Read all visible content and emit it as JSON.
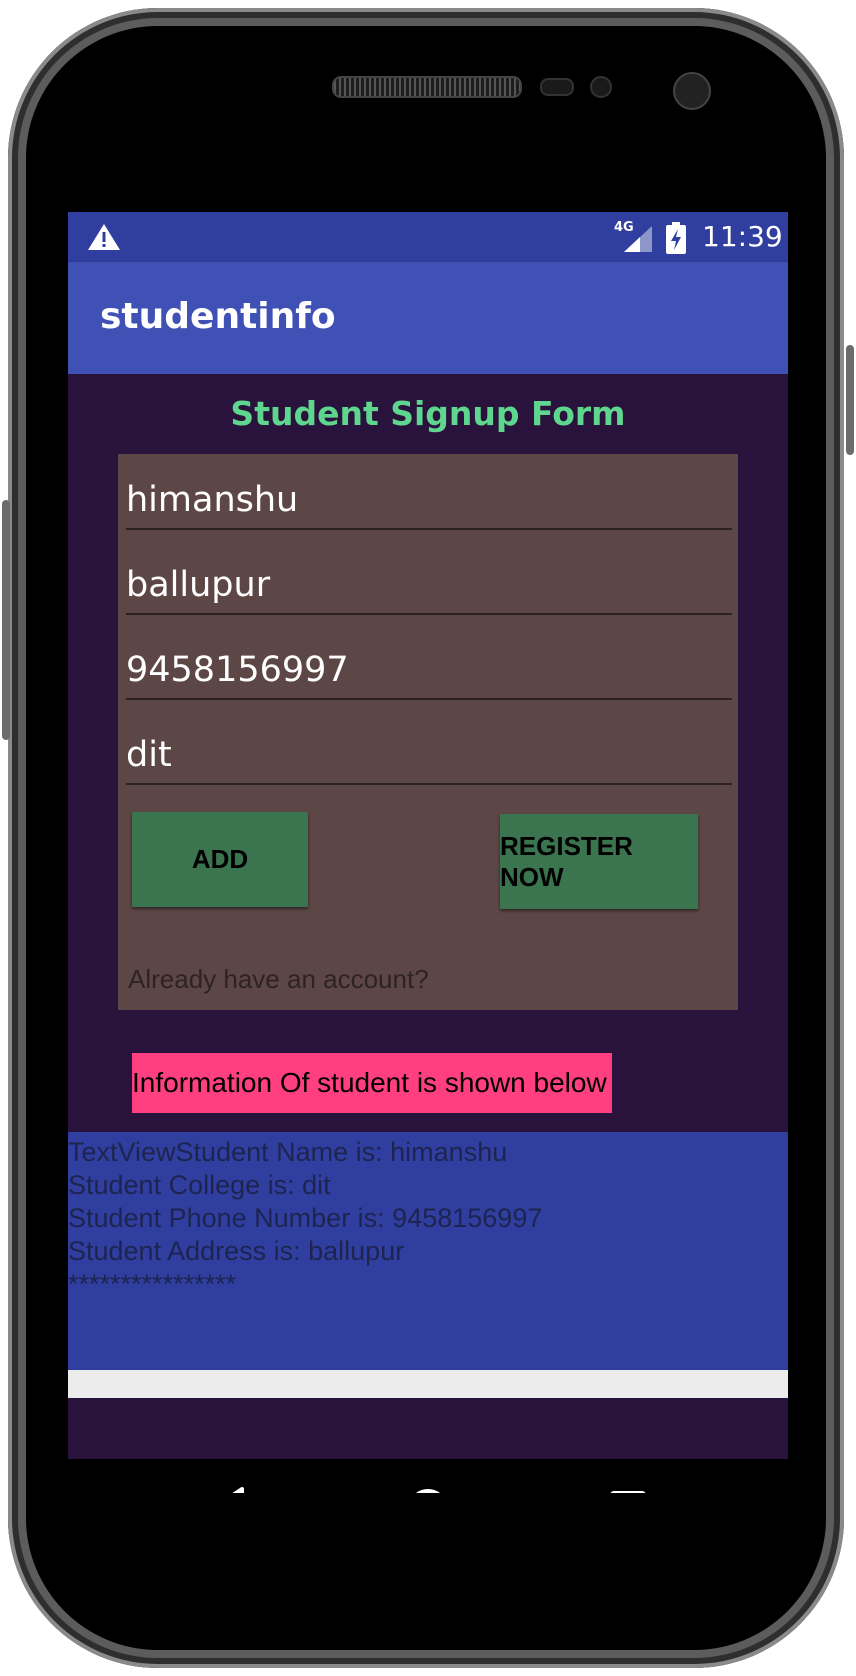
{
  "status_bar": {
    "network_label": "4G",
    "time": "11:39",
    "icons": [
      "warning-icon",
      "signal-icon",
      "battery-charging-icon"
    ]
  },
  "app_bar": {
    "title": "studentinfo"
  },
  "form": {
    "heading": "Student Signup Form",
    "name_value": "himanshu",
    "address_value": "ballupur",
    "phone_value": "9458156997",
    "college_value": "dit",
    "add_label": "ADD",
    "register_label": "REGISTER NOW",
    "already_account": "Already have an account?"
  },
  "info": {
    "banner": "Information Of student is shown below",
    "lines": [
      "TextViewStudent Name is: himanshu",
      "Student College is: dit",
      "Student Phone Number is: 9458156997",
      "Student Address is: ballupur",
      "****************"
    ]
  },
  "nav_bar": {
    "icons": [
      "back-icon",
      "home-icon",
      "recents-icon"
    ]
  },
  "colors": {
    "status_bar": "#303f9f",
    "app_bar": "#3f51b5",
    "form_background": "#29123b",
    "card": "#5d4746",
    "heading": "#5ed68d",
    "button": "#3a754f",
    "banner": "#ff3f7f",
    "info_panel": "#303f9f"
  }
}
